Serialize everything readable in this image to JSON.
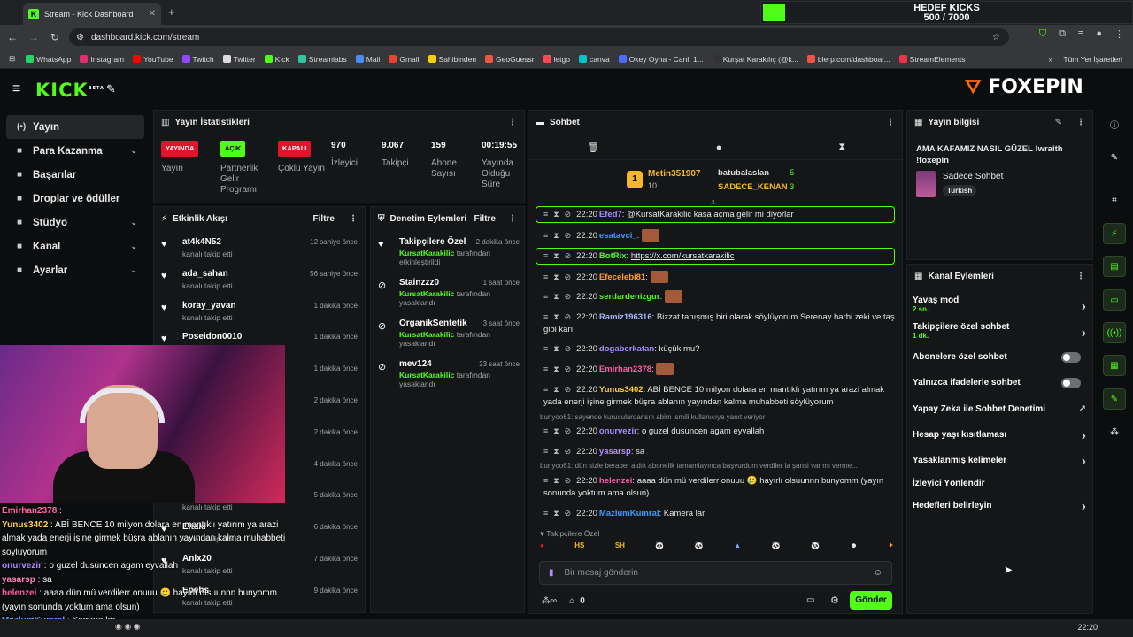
{
  "browser": {
    "tab_title": "Stream - Kick Dashboard",
    "url": "dashboard.kick.com/stream",
    "bookmarks": [
      "WhatsApp",
      "Instagram",
      "YouTube",
      "Twitch",
      "Twitter",
      "Kick",
      "Streamlabs",
      "Mail",
      "Gmail",
      "Sahibinden",
      "GeoGuessr",
      "letgo",
      "canva",
      "Okey Oyna - Canlı 1...",
      "Kurşat Karakılıç (@k...",
      "blerp.com/dashboar...",
      "StreamElements"
    ],
    "all_bookmarks": "Tüm Yer İşaretleri"
  },
  "goal": {
    "title": "HEDEF KICKS",
    "value": "500 / 7000",
    "progress": 0.0714
  },
  "brand": {
    "logo": "KICK",
    "logo_beta": "BETA",
    "partner": "FOXEPIN"
  },
  "sidebar": {
    "items": [
      {
        "label": "Yayın",
        "icon": "stream-icon"
      },
      {
        "label": "Para Kazanma",
        "icon": "money-icon"
      },
      {
        "label": "Başarılar",
        "icon": "trophy-icon"
      },
      {
        "label": "Droplar ve ödüller",
        "icon": "gift-icon"
      },
      {
        "label": "Stüdyo",
        "icon": "studio-icon"
      },
      {
        "label": "Kanal",
        "icon": "channel-icon"
      },
      {
        "label": "Ayarlar",
        "icon": "gear-icon"
      }
    ]
  },
  "stats": {
    "title": "Yayın İstatistikleri",
    "items": [
      {
        "badge": "YAYINDA",
        "label": "Yayın"
      },
      {
        "badge": "AÇIK",
        "label": "Partnerlik Gelir Programı"
      },
      {
        "badge": "KAPALI",
        "label": "Çoklu Yayın"
      },
      {
        "value": "970",
        "label": "İzleyici"
      },
      {
        "value": "9.067",
        "label": "Takipçi"
      },
      {
        "value": "159",
        "label": "Abone Sayısı"
      },
      {
        "value": "00:19:55",
        "label": "Yayında Olduğu Süre"
      }
    ]
  },
  "activity": {
    "title": "Etkinlik Akışı",
    "filter": "Filtre",
    "items": [
      {
        "name": "at4k4N52",
        "sub": "kanalı takip etti",
        "time": "12 saniye önce"
      },
      {
        "name": "ada_sahan",
        "sub": "kanalı takip etti",
        "time": "56 saniye önce"
      },
      {
        "name": "koray_yavan",
        "sub": "kanalı takip etti",
        "time": "1 dakika önce"
      },
      {
        "name": "Poseidon0010",
        "sub": "",
        "time": "1 dakika önce"
      },
      {
        "name": "",
        "sub": "",
        "time": "1 dakika önce"
      },
      {
        "name": "",
        "sub": "",
        "time": "2 dakika önce"
      },
      {
        "name": "",
        "sub": "",
        "time": "2 dakika önce"
      },
      {
        "name": "",
        "sub": "",
        "time": "4 dakika önce"
      },
      {
        "name": "",
        "sub": "kanalı takip etti",
        "time": "5 dakika önce"
      },
      {
        "name": "Eltaki",
        "sub": "kanalı takip etti",
        "time": "6 dakika önce"
      },
      {
        "name": "Anlx20",
        "sub": "kanalı takip etti",
        "time": "7 dakika önce"
      },
      {
        "name": "Epehs",
        "sub": "kanalı takip etti",
        "time": "9 dakika önce"
      }
    ]
  },
  "moderation": {
    "title": "Denetim Eylemleri",
    "filter": "Filtre",
    "items": [
      {
        "name": "Takipçilere Özel",
        "by": "KursatKarakilic",
        "sub": "tarafından etkinleştirildi",
        "time": "2 dakika önce"
      },
      {
        "name": "Stainzzz0",
        "by": "KursatKarakilic",
        "sub": "tarafından yasaklandı",
        "time": "1 saat önce"
      },
      {
        "name": "OrganikSentetik",
        "by": "KursatKarakilic",
        "sub": "tarafından yasaklandı",
        "time": "3 saat önce"
      },
      {
        "name": "mev124",
        "by": "KursatKarakilic",
        "sub": "tarafından yasaklandı",
        "time": "23 saat önce"
      }
    ]
  },
  "chat": {
    "title": "Sohbet",
    "leaderboard": [
      {
        "name": "Metin351907",
        "count": "10"
      },
      {
        "name": "batubalaslan",
        "count": "5"
      },
      {
        "name": "SADECE_KENAN",
        "count": "3"
      }
    ],
    "messages": [
      {
        "time": "22:20",
        "user": "Efed7",
        "color": "#a58bff",
        "text": "@KursatKarakilic kasa açma gelir mi diyorlar"
      },
      {
        "time": "22:20",
        "user": "esatavci_",
        "color": "#3a9bff",
        "text": ""
      },
      {
        "time": "22:20",
        "user": "BotRix",
        "color": "#53fc18",
        "text": "https://x.com/kursatkarakilic"
      },
      {
        "time": "22:20",
        "user": "Efecelebi81",
        "color": "#ff9f2a",
        "text": ""
      },
      {
        "time": "22:20",
        "user": "serdardenizgur",
        "color": "#53fc18",
        "text": ""
      },
      {
        "time": "22:20",
        "user": "Ramiz196316",
        "color": "#a0b8ff",
        "text": "Bizzat tanışmış biri olarak söylüyorum Serenay harbi zeki ve taş gibi karı"
      },
      {
        "time": "22:20",
        "user": "dogaberkatan",
        "color": "#a58bff",
        "text": "küçük mu?"
      },
      {
        "time": "22:20",
        "user": "Emirhan2378",
        "color": "#ff5aa8",
        "text": ""
      },
      {
        "time": "22:20",
        "user": "Yunus3402",
        "color": "#ffcf3a",
        "text": "ABİ BENCE 10 milyon dolara en mantıklı yatırım ya arazi almak yada enerji işine girmek büşra ablanın yayından kalma muhabbeti söylüyorum"
      },
      {
        "time": "22:20",
        "user": "onurvezir",
        "color": "#a58bff",
        "text": "o guzel dusuncen agam eyvallah"
      },
      {
        "time": "22:20",
        "user": "yasarsp",
        "color": "#b48cff",
        "text": "sa"
      },
      {
        "time": "22:20",
        "user": "helenzei",
        "color": "#ff5aa8",
        "text": "aaaa dün mü verdilerr onuuu 🥲 hayırlı olsuunnn bunyomm (yayın sonunda yoktum ama olsun)"
      },
      {
        "time": "22:20",
        "user": "MazlumKumral",
        "color": "#3a9bff",
        "text": "Kamera lar"
      }
    ],
    "replies": [
      "bunyoo61: sayende kuruculardansın abim ismili kullanıcıya yanıt veriyor",
      "bunyoo61: dün sizle beraber aldık abonelik tamamlayınca başvurdum verdiler la şansi var mi verme..."
    ],
    "follower_only": "Takipçilere Özel",
    "placeholder": "Bir mesaj gönderin",
    "send": "Gönder",
    "count": "0"
  },
  "stream_info": {
    "title": "Yayın bilgisi",
    "stream_title": "AMA KAFAMIZ NASIL GÜZEL !wraith !foxepin",
    "category": "Sadece Sohbet",
    "language": "Turkish"
  },
  "channel_actions": {
    "title": "Kanal Eylemleri",
    "items": [
      {
        "label": "Yavaş mod",
        "sub": "2 sn.",
        "type": "chev"
      },
      {
        "label": "Takipçilere özel sohbet",
        "sub": "1 dk.",
        "type": "chev"
      },
      {
        "label": "Abonelere özel sohbet",
        "sub": "",
        "type": "toggle"
      },
      {
        "label": "Yalnızca ifadelerle sohbet",
        "sub": "",
        "type": "toggle"
      },
      {
        "label": "Yapay Zeka ile Sohbet Denetimi",
        "sub": "",
        "type": "ext"
      },
      {
        "label": "Hesap yaşı kısıtlaması",
        "sub": "",
        "type": "chev"
      },
      {
        "label": "Yasaklanmış kelimeler",
        "sub": "",
        "type": "chev"
      },
      {
        "label": "İzleyici Yönlendir",
        "sub": "",
        "type": "none"
      },
      {
        "label": "Hedefleri belirleyin",
        "sub": "",
        "type": "chev"
      }
    ]
  },
  "overlay_chat": [
    {
      "user": "Emirhan2378",
      "text": ":"
    },
    {
      "user": "Yunus3402",
      "text": ": ABİ BENCE 10 milyon dolara en mantıklı yatırım ya arazi almak yada enerji işine girmek büşra ablanın yayından kalma muhabbeti söylüyorum"
    },
    {
      "user": "onurvezir",
      "text": ": o guzel dusuncen agam eyvallah"
    },
    {
      "user": "yasarsp",
      "text": ": sa"
    },
    {
      "user": "helenzei",
      "text": ": aaaa dün mü verdilerr onuuu 🥲 hayırlı olsuunnn bunyomm (yayın sonunda yoktum ama olsun)"
    },
    {
      "user": "MazlumKumral",
      "text": ": Kamera lar"
    }
  ],
  "taskbar": {
    "time": "22:20"
  }
}
